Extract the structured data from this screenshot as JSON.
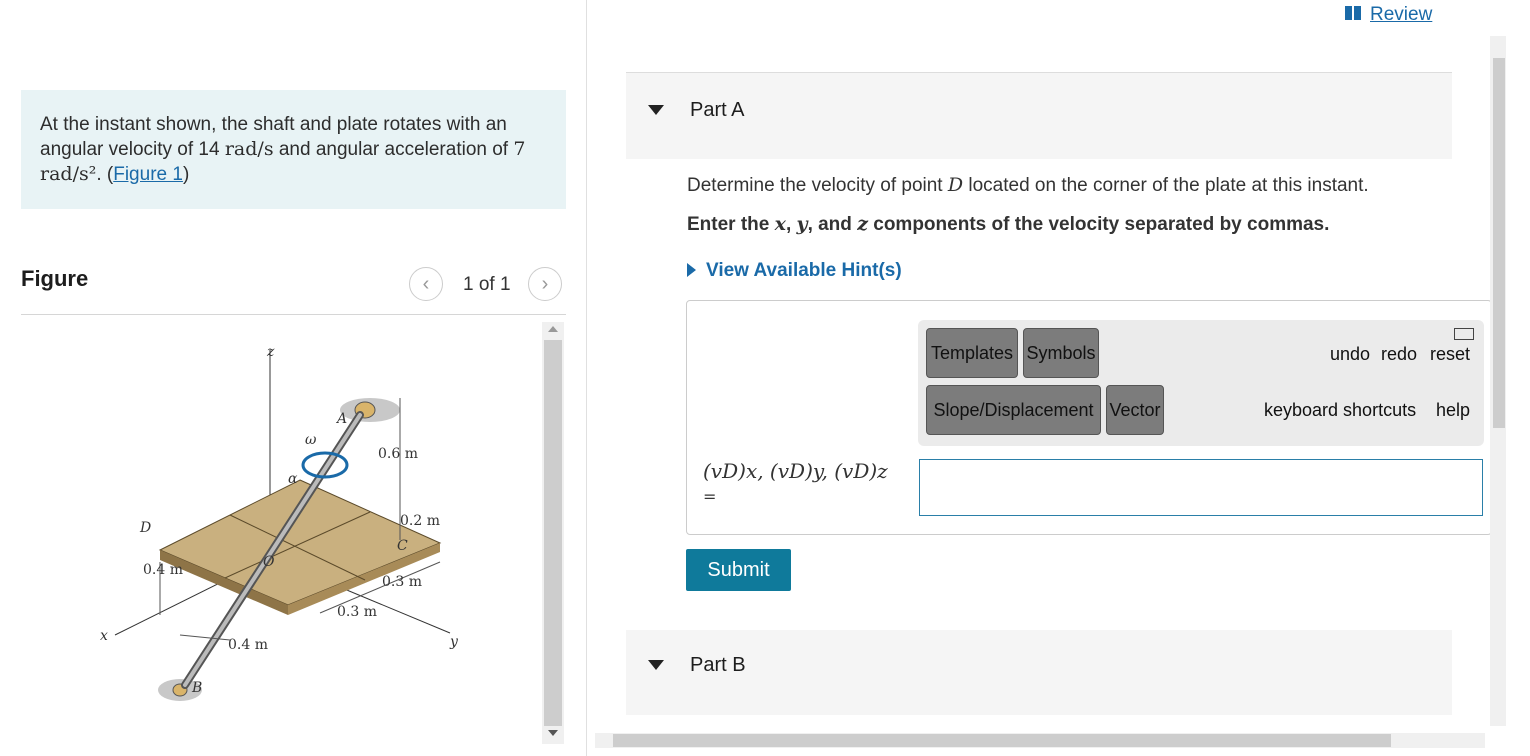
{
  "problem": {
    "text_before": "At the instant shown, the shaft and plate rotates with an angular velocity of 14 ",
    "omega_unit": "rad/s",
    "text_middle": " and angular acceleration of ",
    "alpha_value": "7 ",
    "alpha_unit": "rad/s²",
    "text_after": ". (",
    "figure_link": "Figure 1",
    "close_paren": ")"
  },
  "figure": {
    "title": "Figure",
    "counter": "1 of 1",
    "labels": {
      "z": "z",
      "x": "x",
      "y": "y",
      "A": "A",
      "B": "B",
      "C": "C",
      "D": "D",
      "O": "O",
      "omega": "ω",
      "alpha": "α",
      "d_06": "0.6 m",
      "d_02": "0.2 m",
      "d_03a": "0.3 m",
      "d_03b": "0.3 m",
      "d_04a": "0.4 m",
      "d_04b": "0.4 m"
    }
  },
  "header": {
    "review": "Review"
  },
  "partA": {
    "title": "Part A",
    "question_pre": "Determine the velocity of point ",
    "question_var": "D",
    "question_post": " located on the corner of the plate at this instant.",
    "instruction_pre": "Enter the ",
    "instruction_x": "x",
    "instruction_sep1": ", ",
    "instruction_y": "y",
    "instruction_sep2": ", and ",
    "instruction_z": "z",
    "instruction_post": " components of the velocity separated by commas.",
    "hints": "View Available Hint(s)",
    "toolbar": {
      "templates": "Templates",
      "symbols": "Symbols",
      "slope": "Slope/Displacement",
      "vector": "Vector",
      "undo": "undo",
      "redo": "redo",
      "reset": "reset",
      "shortcuts": "keyboard shortcuts",
      "help": "help"
    },
    "answer_label": "(vD)x, (vD)y, (vD)z",
    "equals": "=",
    "answer_value": "",
    "submit": "Submit"
  },
  "partB": {
    "title": "Part B"
  },
  "colors": {
    "accent": "#0f7a9b",
    "link": "#1a6aa8",
    "problem_bg": "#e8f3f5",
    "plate": "#c9b07f"
  }
}
